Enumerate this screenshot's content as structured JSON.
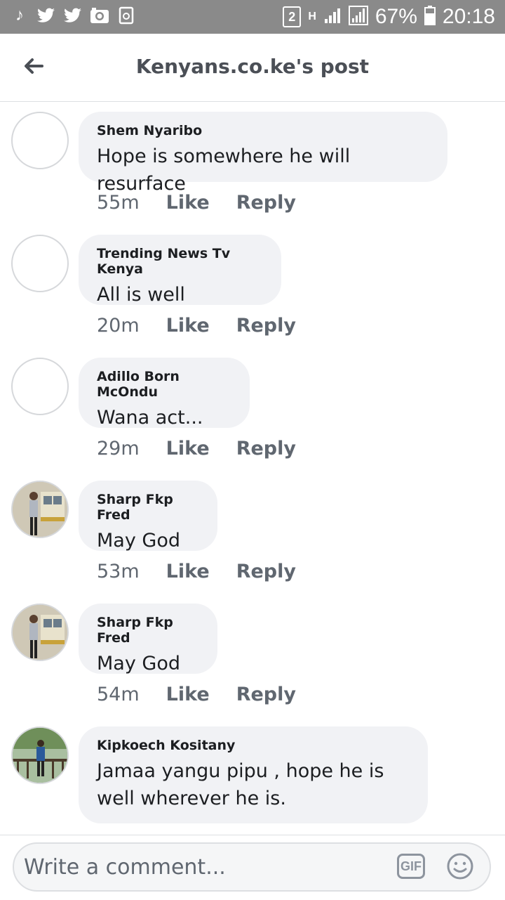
{
  "status": {
    "sim": "2",
    "network": "H",
    "battery": "67%",
    "time": "20:18"
  },
  "header": {
    "title": "Kenyans.co.ke's post"
  },
  "comments": [
    {
      "author": "Shem Nyaribo",
      "text": "Hope is somewhere he will resurface",
      "time": "55m",
      "like": "Like",
      "reply": "Reply"
    },
    {
      "author": "Trending News Tv Kenya",
      "text": "All is well",
      "time": "20m",
      "like": "Like",
      "reply": "Reply"
    },
    {
      "author": "Adillo Born McOndu",
      "text": "Wana act...",
      "time": "29m",
      "like": "Like",
      "reply": "Reply"
    },
    {
      "author": "Sharp Fkp Fred",
      "text": "May God",
      "time": "53m",
      "like": "Like",
      "reply": "Reply"
    },
    {
      "author": "Sharp Fkp Fred",
      "text": "May God",
      "time": "54m",
      "like": "Like",
      "reply": "Reply"
    },
    {
      "author": "Kipkoech Kositany",
      "text": "Jamaa yangu pipu , hope he is well wherever he is.",
      "time": "",
      "like": "",
      "reply": ""
    }
  ],
  "composer": {
    "placeholder": "Write a comment...",
    "gif": "GIF"
  }
}
